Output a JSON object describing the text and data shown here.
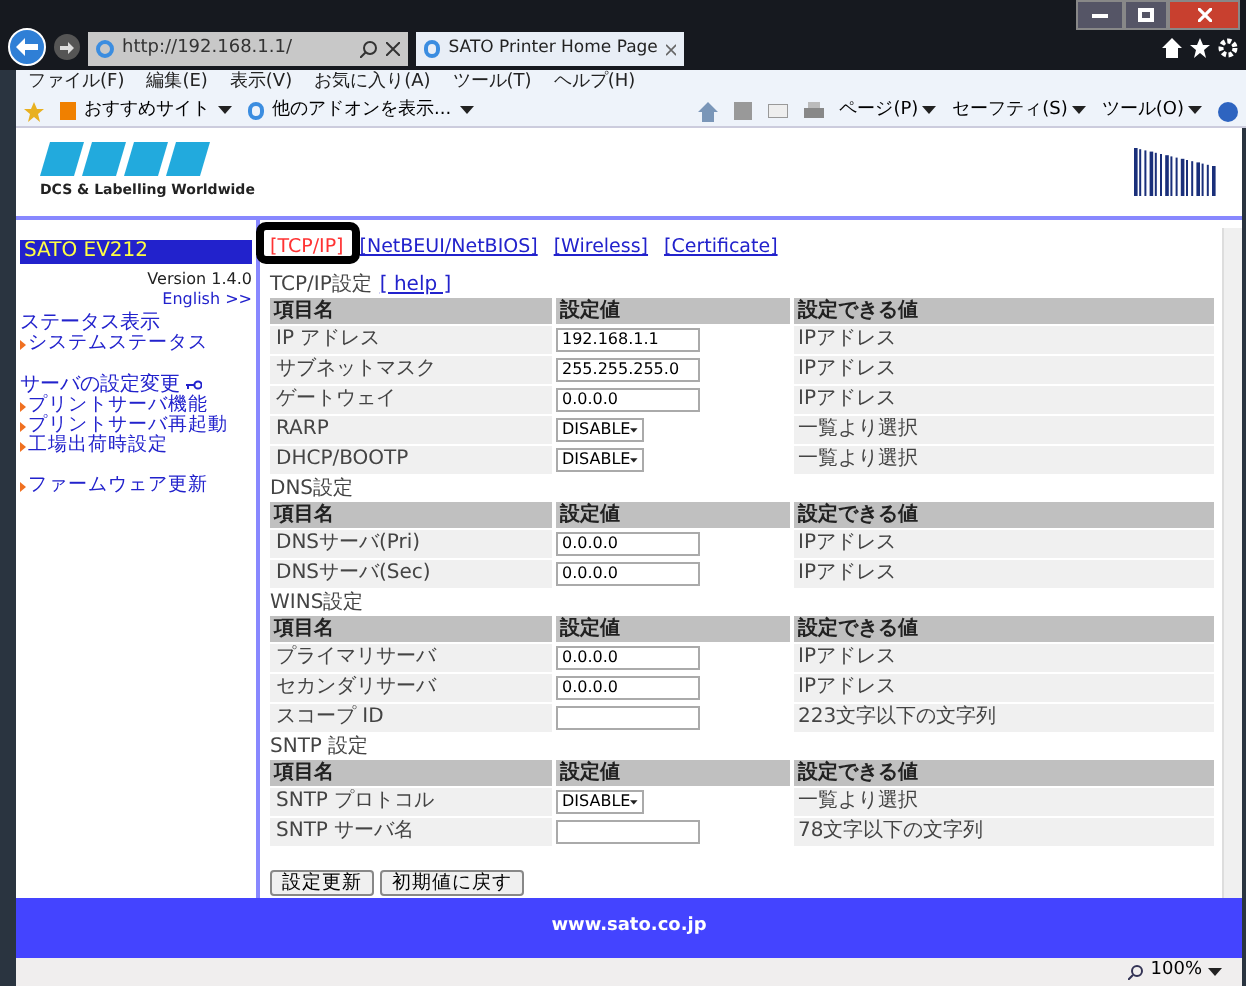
{
  "browser": {
    "address": "http://192.168.1.1/",
    "tab_title": "SATO Printer Home Page",
    "menu": [
      "ファイル(F)",
      "編集(E)",
      "表示(V)",
      "お気に入り(A)",
      "ツール(T)",
      "ヘルプ(H)"
    ],
    "favorites": [
      "おすすめサイト",
      "他のアドオンを表示..."
    ],
    "commands": [
      "ページ(P)",
      "セーフティ(S)",
      "ツール(O)"
    ],
    "zoom": "100%"
  },
  "header": {
    "tagline": "DCS & Labelling Worldwide"
  },
  "sidebar": {
    "model": "SATO EV212",
    "version": "Version 1.4.0",
    "language_link": "English >>",
    "groups": [
      {
        "title": "ステータス表示",
        "key": false,
        "links": [
          "システムステータス"
        ]
      },
      {
        "title": "サーバの設定変更",
        "key": true,
        "links": [
          "プリントサーバ機能",
          "プリントサーバ再起動",
          "工場出荷時設定"
        ]
      },
      {
        "links": [
          "ファームウェア更新"
        ]
      }
    ]
  },
  "tabs": [
    {
      "label": "[TCP/IP]",
      "selected": true
    },
    {
      "label": "[NetBEUI/NetBIOS]",
      "selected": false
    },
    {
      "label": "[Wireless]",
      "selected": false
    },
    {
      "label": "[Certificate]",
      "selected": false
    }
  ],
  "sections": [
    {
      "title": "TCP/IP設定",
      "help": "[ help ]",
      "columns": [
        "項目名",
        "設定値",
        "設定できる値"
      ],
      "rows": [
        {
          "name": "IP アドレス",
          "kind": "text",
          "value": "192.168.1.1",
          "allowed": "IPアドレス"
        },
        {
          "name": "サブネットマスク",
          "kind": "text",
          "value": "255.255.255.0",
          "allowed": "IPアドレス"
        },
        {
          "name": "ゲートウェイ",
          "kind": "text",
          "value": "0.0.0.0",
          "allowed": "IPアドレス"
        },
        {
          "name": "RARP",
          "kind": "select",
          "value": "DISABLE",
          "allowed": "一覧より選択"
        },
        {
          "name": "DHCP/BOOTP",
          "kind": "select",
          "value": "DISABLE",
          "allowed": "一覧より選択"
        }
      ]
    },
    {
      "title": "DNS設定",
      "columns": [
        "項目名",
        "設定値",
        "設定できる値"
      ],
      "rows": [
        {
          "name": "DNSサーバ(Pri)",
          "kind": "text",
          "value": "0.0.0.0",
          "allowed": "IPアドレス"
        },
        {
          "name": "DNSサーバ(Sec)",
          "kind": "text",
          "value": "0.0.0.0",
          "allowed": "IPアドレス"
        }
      ]
    },
    {
      "title": "WINS設定",
      "columns": [
        "項目名",
        "設定値",
        "設定できる値"
      ],
      "rows": [
        {
          "name": "プライマリサーバ",
          "kind": "text",
          "value": "0.0.0.0",
          "allowed": "IPアドレス"
        },
        {
          "name": "セカンダリサーバ",
          "kind": "text",
          "value": "0.0.0.0",
          "allowed": "IPアドレス"
        },
        {
          "name": "スコープ ID",
          "kind": "text",
          "allowed": "223文字以下の文字列"
        }
      ]
    },
    {
      "title": "SNTP 設定",
      "columns": [
        "項目名",
        "設定値",
        "設定できる値"
      ],
      "rows": [
        {
          "name": "SNTP プロトコル",
          "kind": "select",
          "value": "DISABLE",
          "allowed": "一覧より選択"
        },
        {
          "name": "SNTP サーバ名",
          "kind": "text",
          "allowed": "78文字以下の文字列"
        }
      ]
    }
  ],
  "buttons": [
    "設定更新",
    "初期値に戻す"
  ],
  "footer": "www.sato.co.jp"
}
